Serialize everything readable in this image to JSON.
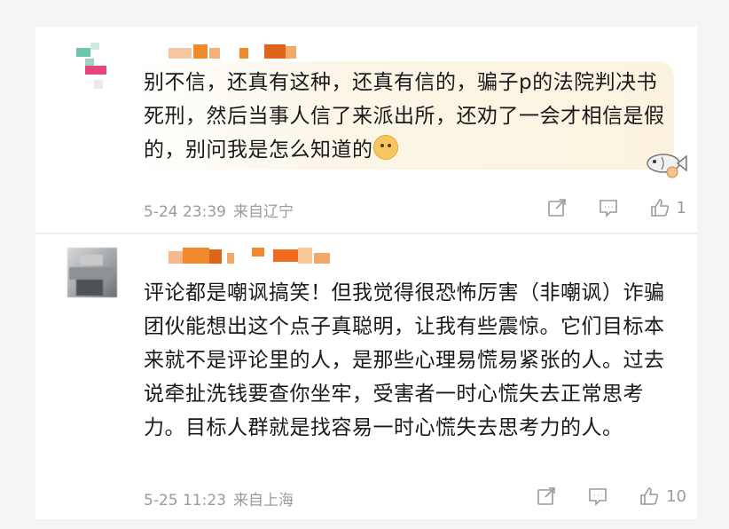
{
  "comments": [
    {
      "text": "别不信，还真有这种，还真有信的，骗子p的法院判决书死刑，然后当事人信了来派出所，还劝了一会才相信是假的，别问我是怎么知道的",
      "emoji": "doge-icon",
      "date": "5-24 23:39",
      "location": "来自辽宁",
      "likes": "1"
    },
    {
      "text": "评论都是嘲讽搞笑！但我觉得很恐怖厉害（非嘲讽）诈骗团伙能想出这个点子真聪明，让我有些震惊。它们目标本来就不是评论里的人，是那些心理易慌易紧张的人。过去说牵扯洗钱要查你坐牢，受害者一时心慌失去正常思考力。目标人群就是找容易一时心慌失去思考力的人。",
      "date": "5-25 11:23",
      "location": "来自上海",
      "likes": "10"
    }
  ],
  "icons": {
    "share": "share-icon",
    "reply": "comment-icon",
    "like": "thumbs-up-icon"
  },
  "colors": {
    "highlight": "#fbf3df",
    "meta": "#9b9b9b",
    "username_blur_orange": "#f08a2c"
  }
}
